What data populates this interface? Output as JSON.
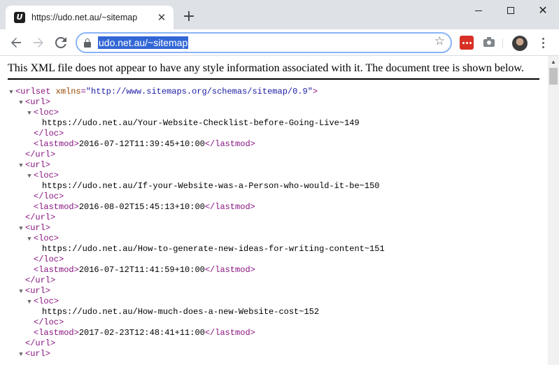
{
  "browser": {
    "tab_title": "https://udo.net.au/~sitemap",
    "tab_favicon_letter": "U",
    "tab_close_glyph": "✕",
    "new_tab_glyph": "+",
    "close_glyph": "✕",
    "url": "udo.net.au/~sitemap",
    "icons": [
      "back-arrow-icon",
      "forward-arrow-icon",
      "reload-icon",
      "lock-icon",
      "star-icon",
      "extension-icon",
      "camera-icon",
      "avatar",
      "kebab-menu-icon"
    ]
  },
  "page": {
    "notice": "This XML file does not appear to have any style information associated with it. The document tree is shown below.",
    "urlset_open": "<urlset",
    "urlset_attr_name": "xmlns",
    "urlset_attr_value": "\"http://www.sitemaps.org/schemas/sitemap/0.9\"",
    "url_open": "<url>",
    "url_close": "</url>",
    "loc_open": "<loc>",
    "loc_close": "</loc>",
    "lastmod_open": "<lastmod>",
    "lastmod_close": "</lastmod>",
    "entries": [
      {
        "loc": "https://udo.net.au/Your-Website-Checklist-before-Going-Live~149",
        "lastmod": "2016-07-12T11:39:45+10:00"
      },
      {
        "loc": "https://udo.net.au/If-your-Website-was-a-Person-who-would-it-be~150",
        "lastmod": "2016-08-02T15:45:13+10:00"
      },
      {
        "loc": "https://udo.net.au/How-to-generate-new-ideas-for-writing-content~151",
        "lastmod": "2016-07-12T11:41:59+10:00"
      },
      {
        "loc": "https://udo.net.au/How-much-does-a-new-Website-cost~152",
        "lastmod": "2017-02-23T12:48:41+11:00"
      }
    ]
  }
}
